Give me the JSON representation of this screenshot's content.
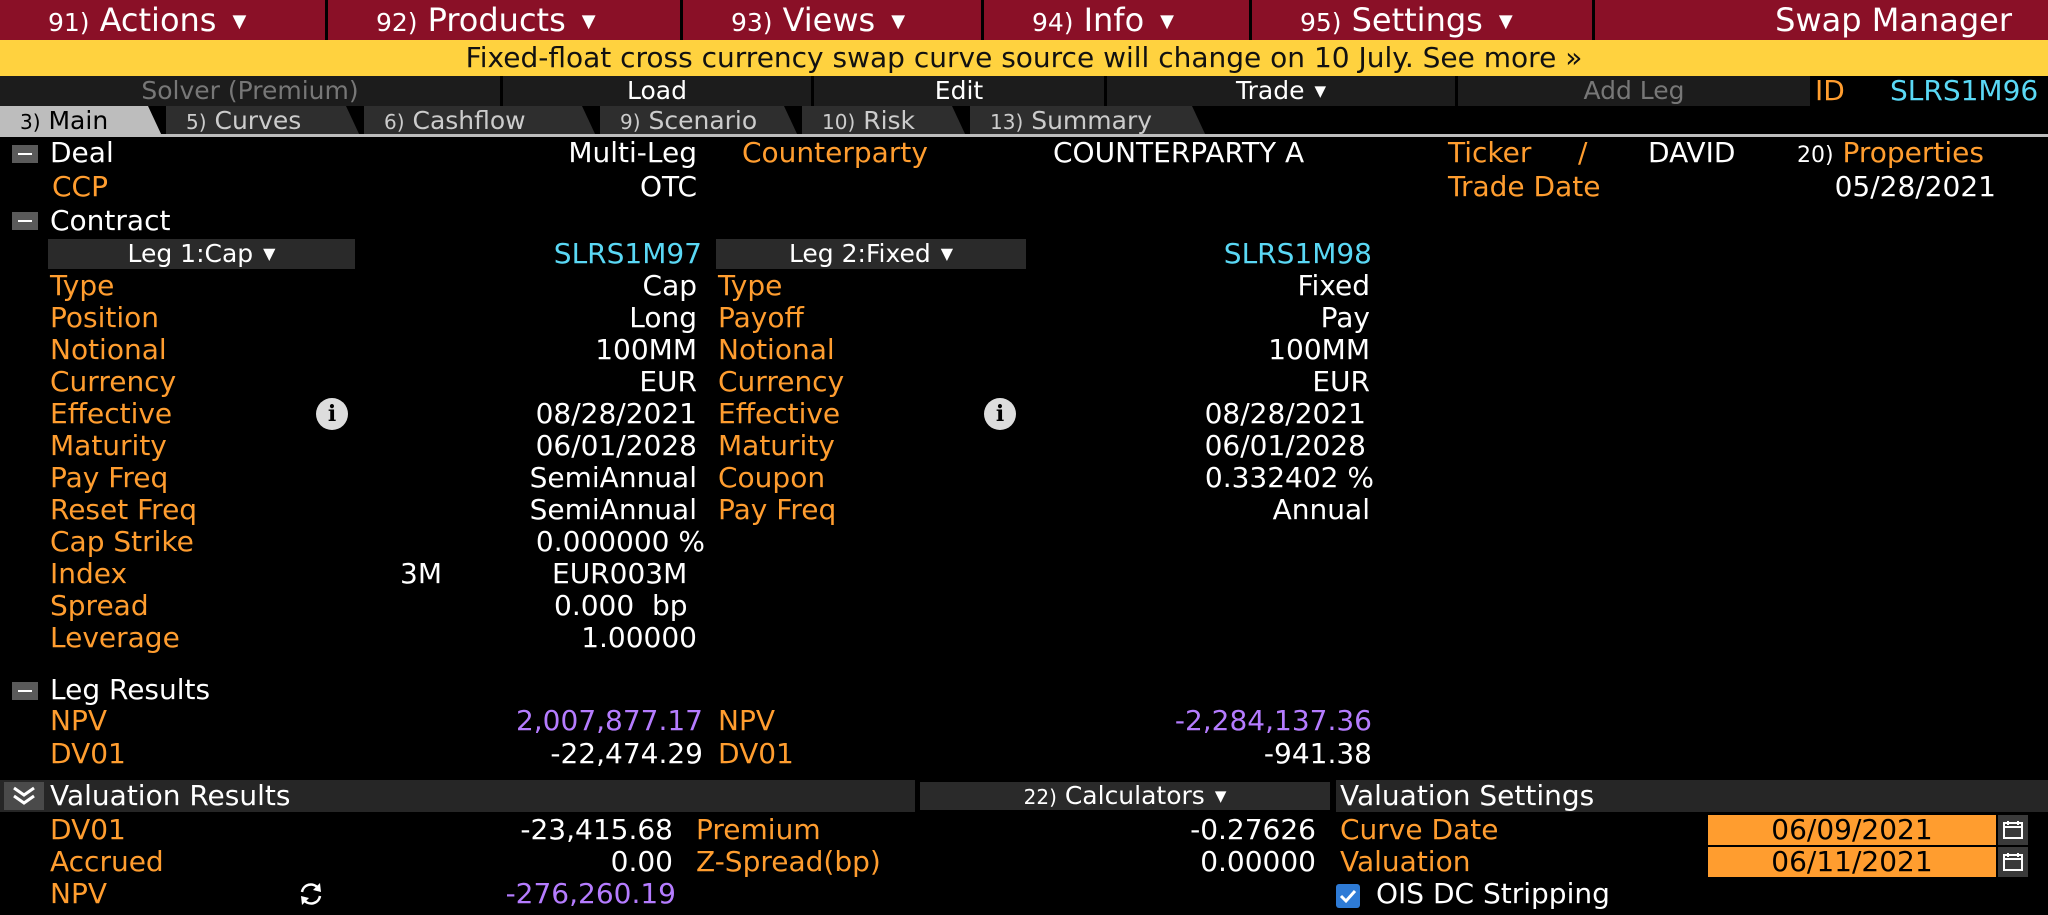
{
  "menu": {
    "actions": {
      "num": "91)",
      "label": "Actions"
    },
    "products": {
      "num": "92)",
      "label": "Products"
    },
    "views": {
      "num": "93)",
      "label": "Views"
    },
    "info": {
      "num": "94)",
      "label": "Info"
    },
    "settings": {
      "num": "95)",
      "label": "Settings"
    },
    "title": "Swap Manager"
  },
  "banner": "Fixed-float cross currency swap curve source will change on 10 July. See more »",
  "toolbar": {
    "solver": "Solver (Premium)",
    "load": "Load",
    "edit": "Edit",
    "trade": "Trade",
    "add_leg": "Add Leg",
    "id_label": "ID",
    "id_value": "SLRS1M96"
  },
  "tabs": [
    {
      "num": "3)",
      "label": "Main"
    },
    {
      "num": "5)",
      "label": "Curves"
    },
    {
      "num": "6)",
      "label": "Cashflow"
    },
    {
      "num": "9)",
      "label": "Scenario"
    },
    {
      "num": "10)",
      "label": "Risk"
    },
    {
      "num": "13)",
      "label": "Summary"
    }
  ],
  "deal": {
    "title": "Deal",
    "type": "Multi-Leg",
    "counterparty_label": "Counterparty",
    "counterparty_value": "COUNTERPARTY A",
    "ticker_label": "Ticker",
    "ticker_sep": "/",
    "ticker_value": "DAVID",
    "properties_num": "20)",
    "properties_label": "Properties",
    "ccp_label": "CCP",
    "ccp_value": "OTC",
    "trade_date_label": "Trade Date",
    "trade_date_value": "05/28/2021"
  },
  "contract": {
    "title": "Contract",
    "leg1": {
      "button": "Leg 1:Cap",
      "id": "SLRS1M97",
      "rows": [
        {
          "label": "Type",
          "value": "Cap"
        },
        {
          "label": "Position",
          "value": "Long"
        },
        {
          "label": "Notional",
          "value": "100MM"
        },
        {
          "label": "Currency",
          "value": "EUR"
        },
        {
          "label": "Effective",
          "value": "08/28/2021"
        },
        {
          "label": "Maturity",
          "value": "06/01/2028"
        },
        {
          "label": "Pay Freq",
          "value": "SemiAnnual"
        },
        {
          "label": "Reset Freq",
          "value": "SemiAnnual"
        },
        {
          "label": "Cap Strike",
          "value": "0.000000 %"
        },
        {
          "label": "Index",
          "value": "EUR003M",
          "tenor": "3M"
        },
        {
          "label": "Spread",
          "value": "0.000  bp"
        },
        {
          "label": "Leverage",
          "value": "1.00000"
        }
      ]
    },
    "leg2": {
      "button": "Leg 2:Fixed",
      "id": "SLRS1M98",
      "rows": [
        {
          "label": "Type",
          "value": "Fixed"
        },
        {
          "label": "Payoff",
          "value": "Pay"
        },
        {
          "label": "Notional",
          "value": "100MM"
        },
        {
          "label": "Currency",
          "value": "EUR"
        },
        {
          "label": "Effective",
          "value": "08/28/2021"
        },
        {
          "label": "Maturity",
          "value": "06/01/2028"
        },
        {
          "label": "Coupon",
          "value": "0.332402 %"
        },
        {
          "label": "Pay Freq",
          "value": "Annual"
        }
      ]
    }
  },
  "leg_results": {
    "title": "Leg Results",
    "leg1": {
      "npv_label": "NPV",
      "npv": "2,007,877.17",
      "dv01_label": "DV01",
      "dv01": "-22,474.29"
    },
    "leg2": {
      "npv_label": "NPV",
      "npv": "-2,284,137.36",
      "dv01_label": "DV01",
      "dv01": "-941.38"
    }
  },
  "valuation": {
    "title": "Valuation Results",
    "calculators_num": "22)",
    "calculators": "Calculators",
    "rows_left": [
      {
        "label": "DV01",
        "value": "-23,415.68"
      },
      {
        "label": "Accrued",
        "value": "0.00"
      },
      {
        "label": "NPV",
        "value": "-276,260.19"
      }
    ],
    "rows_mid": [
      {
        "label": "Premium",
        "value": "-0.27626"
      },
      {
        "label": "Z-Spread(bp)",
        "value": "0.00000"
      }
    ]
  },
  "valuation_settings": {
    "title": "Valuation Settings",
    "curve_date_label": "Curve Date",
    "curve_date": "06/09/2021",
    "valuation_label": "Valuation",
    "valuation_date": "06/11/2021",
    "ois_label": "OIS DC Stripping"
  },
  "colors": {
    "menu_bg": "#8a1027",
    "banner_bg": "#ffd23f",
    "label_amber": "#ff9d2f",
    "id_cyan": "#5ad8f5",
    "npv_purple": "#b57cff"
  }
}
